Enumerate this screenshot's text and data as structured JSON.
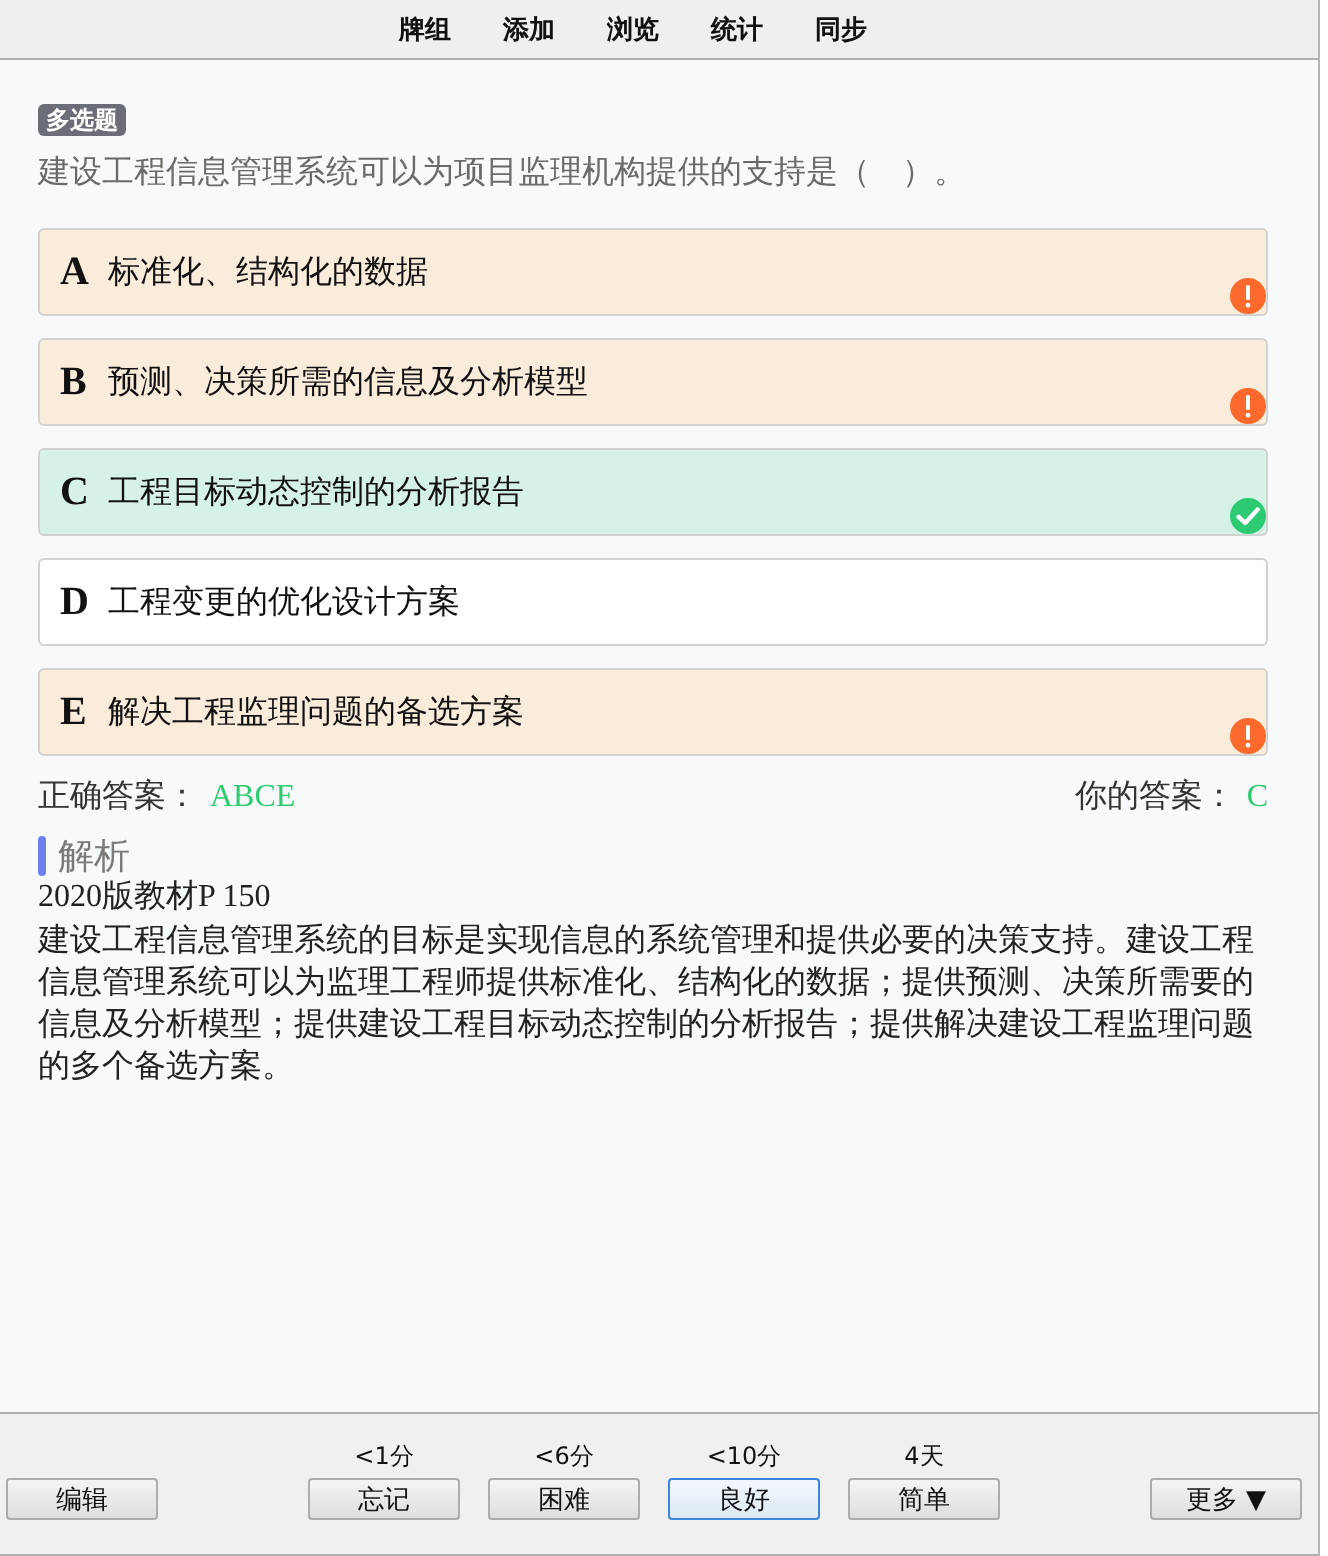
{
  "toolbar": {
    "items": [
      "牌组",
      "添加",
      "浏览",
      "统计",
      "同步"
    ]
  },
  "question": {
    "type_badge": "多选题",
    "text": "建设工程信息管理系统可以为项目监理机构提供的支持是（　）。",
    "options": [
      {
        "letter": "A",
        "text": "标准化、结构化的数据",
        "correct": true,
        "selected": false
      },
      {
        "letter": "B",
        "text": "预测、决策所需的信息及分析模型",
        "correct": true,
        "selected": false
      },
      {
        "letter": "C",
        "text": "工程目标动态控制的分析报告",
        "correct": true,
        "selected": true
      },
      {
        "letter": "D",
        "text": "工程变更的优化设计方案",
        "correct": false,
        "selected": false
      },
      {
        "letter": "E",
        "text": "解决工程监理问题的备选方案",
        "correct": true,
        "selected": false
      }
    ]
  },
  "answers": {
    "correct_label": "正确答案：",
    "correct": "ABCE",
    "yours_label": "你的答案：",
    "yours": "C"
  },
  "explanation": {
    "heading": "解析",
    "source": "2020版教材P 150",
    "text": "建设工程信息管理系统的目标是实现信息的系统管理和提供必要的决策支持。建设工程信息管理系统可以为监理工程师提供标准化、结构化的数据；提供预测、决策所需要的信息及分析模型；提供建设工程目标动态控制的分析报告；提供解决建设工程监理问题的多个备选方案。"
  },
  "bottom_bar": {
    "edit_button": "编辑",
    "answer_buttons": [
      {
        "interval": "<1分",
        "label": "忘记",
        "focused": false
      },
      {
        "interval": "<6分",
        "label": "困难",
        "focused": false
      },
      {
        "interval": "<10分",
        "label": "良好",
        "focused": true
      },
      {
        "interval": "4天",
        "label": "简单",
        "focused": false
      }
    ],
    "more_button": "更多 ▼"
  }
}
